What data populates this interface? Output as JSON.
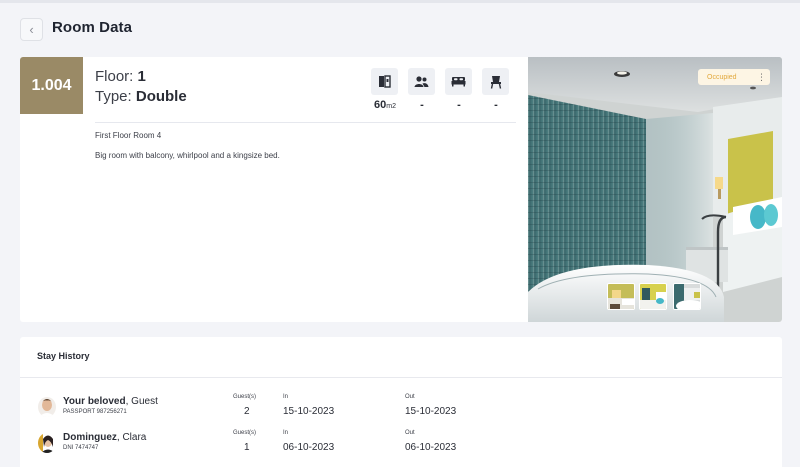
{
  "page": {
    "title": "Room Data"
  },
  "room": {
    "number": "1.004",
    "floor_label": "Floor:",
    "floor_value": "1",
    "type_label": "Type:",
    "type_value": "Double",
    "name": "First Floor Room 4",
    "description": "Big room with balcony, whirlpool and a kingsize bed.",
    "amenities": [
      {
        "icon": "door-icon",
        "value": "60",
        "unit": "m2"
      },
      {
        "icon": "guests-icon",
        "value": "-",
        "unit": ""
      },
      {
        "icon": "bed-icon",
        "value": "-",
        "unit": ""
      },
      {
        "icon": "chair-icon",
        "value": "-",
        "unit": ""
      }
    ],
    "status": "Occupied"
  },
  "history": {
    "title": "Stay History",
    "rows": [
      {
        "name_bold": "Your beloved",
        "name_rest": ", Guest",
        "doc": "PASSPORT 987256271",
        "guests_label": "Guest(s)",
        "guests": "2",
        "in_label": "In",
        "in": "15-10-2023",
        "out_label": "Out",
        "out": "15-10-2023"
      },
      {
        "name_bold": "Dominguez",
        "name_rest": ", Clara",
        "doc": "DNI 7474747",
        "guests_label": "Guest(s)",
        "guests": "1",
        "in_label": "In",
        "in": "06-10-2023",
        "out_label": "Out",
        "out": "06-10-2023"
      }
    ]
  },
  "colors": {
    "room_number_bg": "#9a8a66",
    "status_text": "#e2a93e",
    "status_bg": "#fdf5e4",
    "page_bg": "#f3f4f8"
  }
}
